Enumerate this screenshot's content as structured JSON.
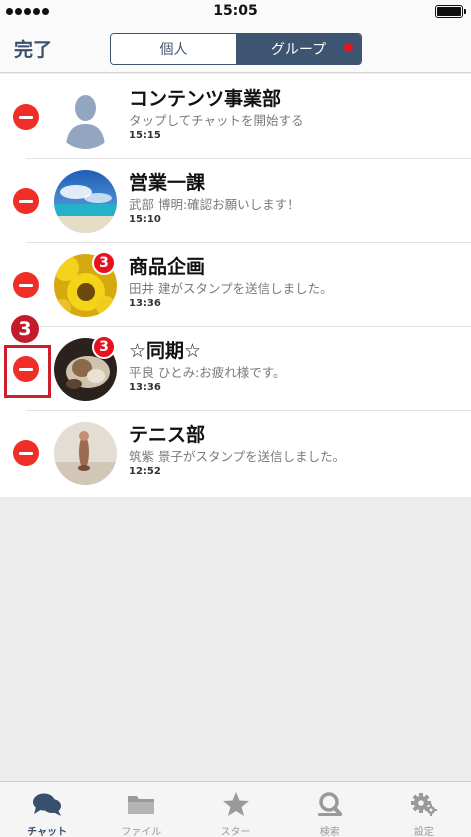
{
  "status_bar": {
    "time": "15:05"
  },
  "nav": {
    "done_label": "完了",
    "segments": [
      {
        "label": "個人",
        "selected": false
      },
      {
        "label": "グループ",
        "selected": true
      }
    ]
  },
  "chats": [
    {
      "name": "コンテンツ事業部",
      "message": "タップしてチャットを開始する",
      "time": "15:15",
      "badge": null,
      "avatar": "default-person-icon"
    },
    {
      "name": "営業一課",
      "message": "武部 博明:確認お願いします！",
      "time": "15:10",
      "badge": null,
      "avatar": "beach-photo"
    },
    {
      "name": "商品企画",
      "message": "田井 建がスタンプを送信しました。",
      "time": "13:36",
      "badge": "3",
      "avatar": "sunflower-photo"
    },
    {
      "name": "☆同期☆",
      "message": "平良 ひとみ:お疲れ様です。",
      "time": "13:36",
      "badge": "3",
      "avatar": "cat-photo"
    },
    {
      "name": "テニス部",
      "message": "筑紫 景子がスタンプを送信しました。",
      "time": "12:52",
      "badge": null,
      "avatar": "tennis-photo"
    }
  ],
  "annotation": {
    "number": "3"
  },
  "tabs": [
    {
      "label": "チャット",
      "icon": "chat-bubbles-icon",
      "active": true
    },
    {
      "label": "ファイル",
      "icon": "folder-icon",
      "active": false
    },
    {
      "label": "スター",
      "icon": "star-icon",
      "active": false
    },
    {
      "label": "検索",
      "icon": "search-icon",
      "active": false
    },
    {
      "label": "設定",
      "icon": "gear-icon",
      "active": false
    }
  ],
  "colors": {
    "accent": "#3e5571",
    "delete": "#ef2f27",
    "badge": "#e8111f",
    "annotation": "#c41a2a"
  }
}
